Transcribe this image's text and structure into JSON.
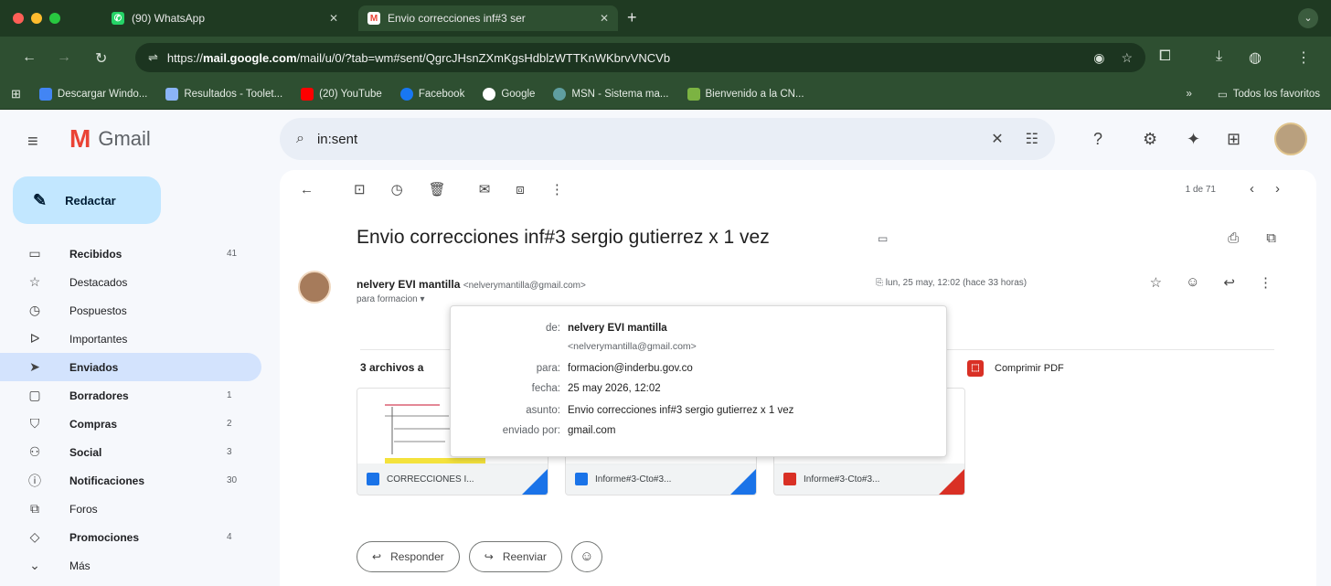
{
  "browser": {
    "tabs": [
      {
        "title": "(90) WhatsApp",
        "active": false
      },
      {
        "title": "Envio correcciones inf#3 ser",
        "active": true
      }
    ],
    "url_prefix": "https://",
    "url_host": "mail.google.com",
    "url_path": "/mail/u/0/?tab=wm#sent/QgrcJHsnZXmKgsHdblzWTTKnWKbrvVNCVb",
    "bookmarks": [
      {
        "label": "Descargar Windo...",
        "color": "#4285f4"
      },
      {
        "label": "Resultados - Toolet...",
        "color": "#8ab4f8"
      },
      {
        "label": "(20) YouTube",
        "color": "#ff0000"
      },
      {
        "label": "Facebook",
        "color": "#1877f2"
      },
      {
        "label": "Google",
        "color": "#ffffff"
      },
      {
        "label": "MSN - Sistema ma...",
        "color": "#5f9ea0"
      },
      {
        "label": "Bienvenido a la CN...",
        "color": "#7cb342"
      }
    ],
    "bookmarks_more": "»",
    "all_bookmarks": "Todos los favoritos"
  },
  "gmail": {
    "logo_text": "Gmail",
    "search_query": "in:sent",
    "compose_label": "Redactar",
    "nav": [
      {
        "label": "Recibidos",
        "count": "41",
        "bold": true,
        "icon": "inbox-icon",
        "glyph": "▭"
      },
      {
        "label": "Destacados",
        "count": "",
        "bold": false,
        "icon": "star-icon",
        "glyph": "☆"
      },
      {
        "label": "Pospuestos",
        "count": "",
        "bold": false,
        "icon": "clock-icon",
        "glyph": "◷"
      },
      {
        "label": "Importantes",
        "count": "",
        "bold": false,
        "icon": "label-important-icon",
        "glyph": "ᐅ"
      },
      {
        "label": "Enviados",
        "count": "",
        "bold": true,
        "icon": "send-icon",
        "glyph": "➤",
        "active": true
      },
      {
        "label": "Borradores",
        "count": "1",
        "bold": true,
        "icon": "draft-icon",
        "glyph": "▢"
      },
      {
        "label": "Compras",
        "count": "2",
        "bold": true,
        "icon": "shopping-icon",
        "glyph": "⛉"
      },
      {
        "label": "Social",
        "count": "3",
        "bold": true,
        "icon": "people-icon",
        "glyph": "⚇"
      },
      {
        "label": "Notificaciones",
        "count": "30",
        "bold": true,
        "icon": "info-icon",
        "glyph": "ⓘ"
      },
      {
        "label": "Foros",
        "count": "",
        "bold": false,
        "icon": "forum-icon",
        "glyph": "⧉"
      },
      {
        "label": "Promociones",
        "count": "4",
        "bold": true,
        "icon": "tag-icon",
        "glyph": "◇"
      },
      {
        "label": "Más",
        "count": "",
        "bold": false,
        "icon": "expand-more-icon",
        "glyph": "⌄"
      }
    ],
    "pager": "1 de 71",
    "message": {
      "subject": "Envio correcciones inf#3 sergio gutierrez x 1 vez",
      "sender_name": "nelvery EVI mantilla",
      "sender_email": "<nelverymantilla@gmail.com>",
      "to_line": "para formacion ▾",
      "date": "lun, 25 may, 12:02 (hace 33 horas)",
      "attachments_heading": "3 archivos a",
      "compress_pdf": "Comprimir PDF",
      "attachments": [
        {
          "name": "CORRECCIONES I...",
          "type": "doc",
          "color": "#1a73e8"
        },
        {
          "name": "Informe#3-Cto#3...",
          "type": "doc",
          "color": "#1a73e8"
        },
        {
          "name": "Informe#3-Cto#3...",
          "type": "pdf",
          "color": "#d93025"
        }
      ],
      "reply_label": "Responder",
      "forward_label": "Reenviar"
    },
    "details": {
      "de_label": "de:",
      "de_name": "nelvery EVI mantilla",
      "de_email": "<nelverymantilla@gmail.com>",
      "para_label": "para:",
      "para_value": "formacion@inderbu.gov.co",
      "fecha_label": "fecha:",
      "fecha_value": "25 may 2026, 12:02",
      "asunto_label": "asunto:",
      "asunto_value": "Envio correcciones inf#3 sergio gutierrez x 1 vez",
      "enviado_label": "enviado por:",
      "enviado_value": "gmail.com"
    }
  }
}
